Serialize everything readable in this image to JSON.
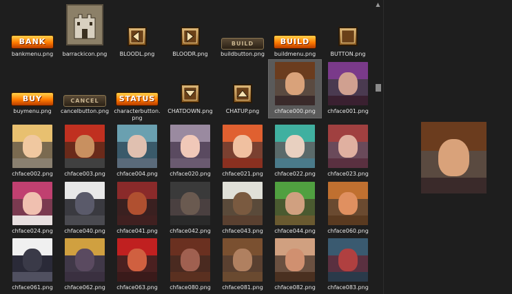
{
  "files": [
    {
      "name": "bankmenu.png",
      "kind": "orange-btn",
      "text": "BANK"
    },
    {
      "name": "barrackicon.png",
      "kind": "castle"
    },
    {
      "name": "BLOODL.png",
      "kind": "arrow",
      "dir": "left"
    },
    {
      "name": "BLOODR.png",
      "kind": "arrow",
      "dir": "right"
    },
    {
      "name": "buildbutton.png",
      "kind": "dark-btn",
      "text": "BUILD"
    },
    {
      "name": "buildmenu.png",
      "kind": "orange-btn",
      "text": "BUILD"
    },
    {
      "name": "BUTTON.png",
      "kind": "arrow",
      "dir": "none"
    },
    {
      "name": "buymenu.png",
      "kind": "orange-btn",
      "text": "BUY"
    },
    {
      "name": "cancelbutton.png",
      "kind": "dark-btn",
      "text": "CANCEL"
    },
    {
      "name": "characterbutton.png",
      "kind": "orange-btn",
      "text": "STATUS"
    },
    {
      "name": "CHATDOWN.png",
      "kind": "arrow",
      "dir": "down"
    },
    {
      "name": "CHATUP.png",
      "kind": "arrow",
      "dir": "up"
    },
    {
      "name": "chface000.png",
      "kind": "portrait",
      "hair": "#6b3c1e",
      "skin": "#d9a27a",
      "body": "#3a2a2a",
      "bg": "#5a4a40",
      "selected": true
    },
    {
      "name": "chface001.png",
      "kind": "portrait",
      "hair": "#7a3a8a",
      "skin": "#d0a090",
      "body": "#3a2030",
      "bg": "#4a3a50"
    },
    {
      "name": "chface002.png",
      "kind": "portrait",
      "hair": "#e8c070",
      "skin": "#f0c8a0",
      "body": "#8a8070",
      "bg": "#7a6a50"
    },
    {
      "name": "chface003.png",
      "kind": "portrait",
      "hair": "#c03020",
      "skin": "#c89060",
      "body": "#404040",
      "bg": "#6a2a1a"
    },
    {
      "name": "chface004.png",
      "kind": "portrait",
      "hair": "#6aa0b0",
      "skin": "#e0c0b0",
      "body": "#5a6a7a",
      "bg": "#3a5a6a"
    },
    {
      "name": "chface020.png",
      "kind": "portrait",
      "hair": "#9a8aa0",
      "skin": "#f0c8b8",
      "body": "#6a5a70",
      "bg": "#5a4a60"
    },
    {
      "name": "chface021.png",
      "kind": "portrait",
      "hair": "#e06030",
      "skin": "#f0c0a0",
      "body": "#8a3020",
      "bg": "#7a4030"
    },
    {
      "name": "chface022.png",
      "kind": "portrait",
      "hair": "#40b0a0",
      "skin": "#e8d0c0",
      "body": "#4a7a8a",
      "bg": "#5a6a6a"
    },
    {
      "name": "chface023.png",
      "kind": "portrait",
      "hair": "#a04040",
      "skin": "#e0b0a0",
      "body": "#5a3040",
      "bg": "#6a4a5a"
    },
    {
      "name": "chface024.png",
      "kind": "portrait",
      "hair": "#c04070",
      "skin": "#f0c0b0",
      "body": "#e8e0e0",
      "bg": "#7a3a50"
    },
    {
      "name": "chface040.png",
      "kind": "portrait",
      "hair": "#e8e8e8",
      "skin": "#5a5a6a",
      "body": "#4a4a50",
      "bg": "#3a3a40"
    },
    {
      "name": "chface041.png",
      "kind": "portrait",
      "hair": "#8a2a2a",
      "skin": "#b05030",
      "body": "#402020",
      "bg": "#3a2020"
    },
    {
      "name": "chface042.png",
      "kind": "portrait",
      "hair": "#3a3a3a",
      "skin": "#6a5a50",
      "body": "#2a2a2a",
      "bg": "#4a4040"
    },
    {
      "name": "chface043.png",
      "kind": "portrait",
      "hair": "#e0e0d8",
      "skin": "#7a5a40",
      "body": "#5a4030",
      "bg": "#5a4a3a"
    },
    {
      "name": "chface044.png",
      "kind": "portrait",
      "hair": "#50a040",
      "skin": "#d0a080",
      "body": "#6a5a30",
      "bg": "#4a5a30"
    },
    {
      "name": "chface060.png",
      "kind": "portrait",
      "hair": "#c07030",
      "skin": "#e09060",
      "body": "#5a3a20",
      "bg": "#6a4a30"
    },
    {
      "name": "chface061.png",
      "kind": "portrait",
      "hair": "#f0f0f0",
      "skin": "#3a3a48",
      "body": "#505060",
      "bg": "#2a2a38"
    },
    {
      "name": "chface062.png",
      "kind": "portrait",
      "hair": "#d0a040",
      "skin": "#5a4a60",
      "body": "#3a3040",
      "bg": "#403848"
    },
    {
      "name": "chface063.png",
      "kind": "portrait",
      "hair": "#c02020",
      "skin": "#d06040",
      "body": "#3a1a1a",
      "bg": "#4a2020"
    },
    {
      "name": "chface080.png",
      "kind": "portrait",
      "hair": "#6a3020",
      "skin": "#a06050",
      "body": "#5a3020",
      "bg": "#4a2a20"
    },
    {
      "name": "chface081.png",
      "kind": "portrait",
      "hair": "#7a5030",
      "skin": "#b08060",
      "body": "#6a4a30",
      "bg": "#5a4030"
    },
    {
      "name": "chface082.png",
      "kind": "portrait",
      "hair": "#d0a080",
      "skin": "#d09070",
      "body": "#4a3020",
      "bg": "#6a5040"
    },
    {
      "name": "chface083.png",
      "kind": "portrait",
      "hair": "#3a5a70",
      "skin": "#b04040",
      "body": "#2a3a4a",
      "bg": "#5a3040"
    }
  ],
  "preview": {
    "hair": "#6b3c1e",
    "skin": "#d9a27a",
    "body": "#3a2a2a",
    "bg": "#5a4a40"
  },
  "scrollbar": {
    "up_glyph": "▲"
  }
}
